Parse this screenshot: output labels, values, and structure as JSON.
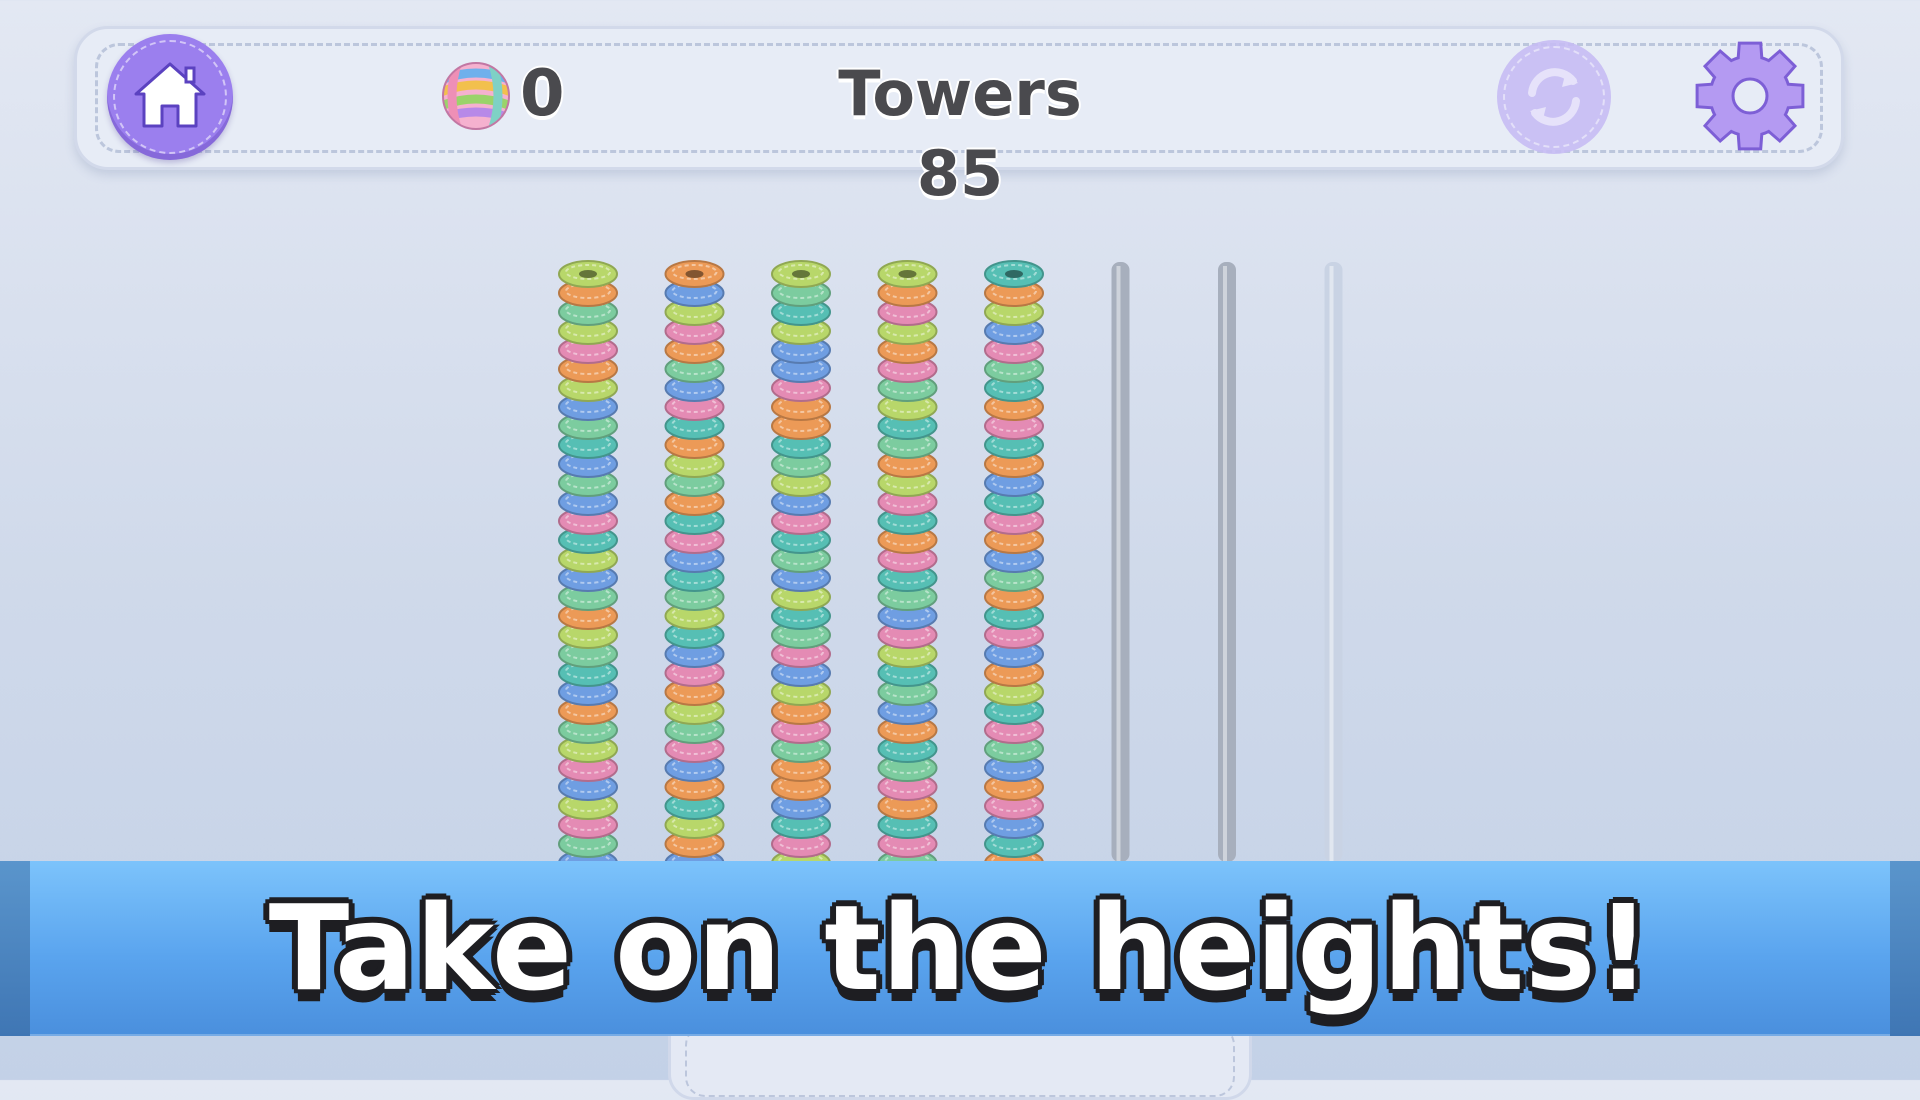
{
  "header": {
    "coins": "0",
    "level_title": "Towers 85"
  },
  "icons": {
    "home": "home-icon",
    "coin": "yarn-ball-icon",
    "refresh": "refresh-icon",
    "settings": "gear-icon"
  },
  "colors": {
    "accent_purple": "#9b7fee",
    "banner_blue": "#5aa4ee",
    "ring_yellow": "#b8d76a",
    "ring_orange": "#ec9a57",
    "ring_blue": "#6f9ee2",
    "ring_pink": "#e48bb4",
    "ring_green": "#7ccc9f",
    "ring_teal": "#56bfb4"
  },
  "towers": [
    {
      "rings": [
        "yellow",
        "orange",
        "green",
        "yellow",
        "pink",
        "orange",
        "yellow",
        "blue",
        "green",
        "teal",
        "blue",
        "green",
        "blue",
        "pink",
        "teal",
        "yellow",
        "blue",
        "green",
        "orange",
        "yellow",
        "green",
        "teal",
        "blue",
        "orange",
        "green",
        "yellow",
        "pink",
        "blue",
        "yellow",
        "pink",
        "green",
        "blue"
      ]
    },
    {
      "rings": [
        "orange",
        "blue",
        "yellow",
        "pink",
        "orange",
        "green",
        "blue",
        "pink",
        "teal",
        "orange",
        "yellow",
        "green",
        "orange",
        "teal",
        "pink",
        "blue",
        "teal",
        "green",
        "yellow",
        "teal",
        "blue",
        "pink",
        "orange",
        "yellow",
        "green",
        "pink",
        "blue",
        "orange",
        "teal",
        "yellow",
        "orange",
        "blue"
      ]
    },
    {
      "rings": [
        "yellow",
        "green",
        "teal",
        "yellow",
        "blue",
        "blue",
        "pink",
        "orange",
        "orange",
        "teal",
        "green",
        "yellow",
        "blue",
        "pink",
        "teal",
        "green",
        "blue",
        "yellow",
        "teal",
        "green",
        "pink",
        "blue",
        "yellow",
        "orange",
        "pink",
        "green",
        "orange",
        "orange",
        "blue",
        "teal",
        "pink",
        "yellow"
      ]
    },
    {
      "rings": [
        "yellow",
        "orange",
        "pink",
        "yellow",
        "orange",
        "pink",
        "green",
        "yellow",
        "teal",
        "green",
        "orange",
        "yellow",
        "pink",
        "teal",
        "orange",
        "pink",
        "teal",
        "green",
        "blue",
        "pink",
        "yellow",
        "teal",
        "green",
        "blue",
        "orange",
        "teal",
        "green",
        "pink",
        "orange",
        "teal",
        "pink",
        "green"
      ]
    },
    {
      "rings": [
        "teal",
        "orange",
        "yellow",
        "blue",
        "pink",
        "green",
        "teal",
        "orange",
        "pink",
        "teal",
        "orange",
        "blue",
        "teal",
        "pink",
        "orange",
        "blue",
        "green",
        "orange",
        "teal",
        "pink",
        "blue",
        "orange",
        "yellow",
        "teal",
        "pink",
        "green",
        "blue",
        "orange",
        "pink",
        "blue",
        "teal",
        "orange"
      ]
    },
    {
      "rings": []
    },
    {
      "rings": []
    },
    {
      "rings": []
    }
  ],
  "banner": {
    "text": "Take on the heights!"
  }
}
